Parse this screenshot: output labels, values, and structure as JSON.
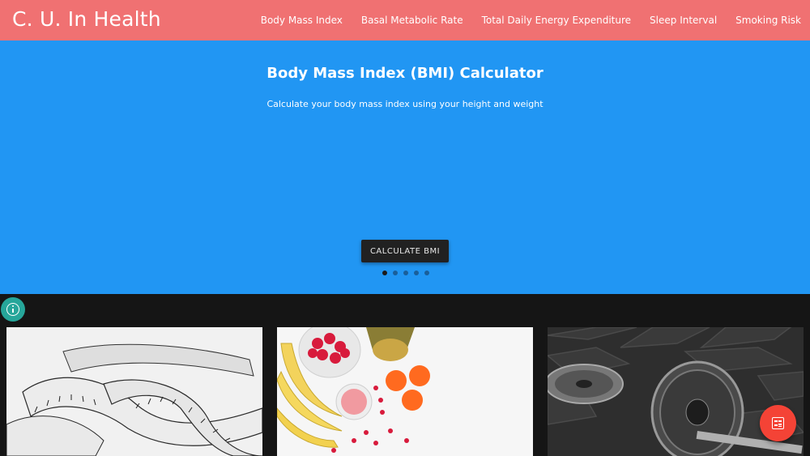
{
  "header": {
    "brand": "C. U. In Health",
    "nav": [
      {
        "label": "Body Mass Index"
      },
      {
        "label": "Basal Metabolic Rate"
      },
      {
        "label": "Total Daily Energy Expenditure"
      },
      {
        "label": "Sleep Interval"
      },
      {
        "label": "Smoking Risk"
      }
    ]
  },
  "hero": {
    "title": "Body Mass Index (BMI) Calculator",
    "subtitle": "Calculate your body mass index using your height and weight",
    "button_label": "CALCULATE BMI",
    "slide_count": 5,
    "active_slide": 1
  },
  "cards": [
    {
      "image": "measuring-tape-image"
    },
    {
      "image": "fruit-smoothie-image"
    },
    {
      "image": "barbell-weights-image"
    }
  ],
  "icons": {
    "info": "info-icon",
    "fab": "calculator-icon"
  },
  "colors": {
    "navbar": "#f07172",
    "hero": "#2196f3",
    "background": "#151515",
    "info_button": "#26a69a",
    "fab": "#f44336"
  }
}
